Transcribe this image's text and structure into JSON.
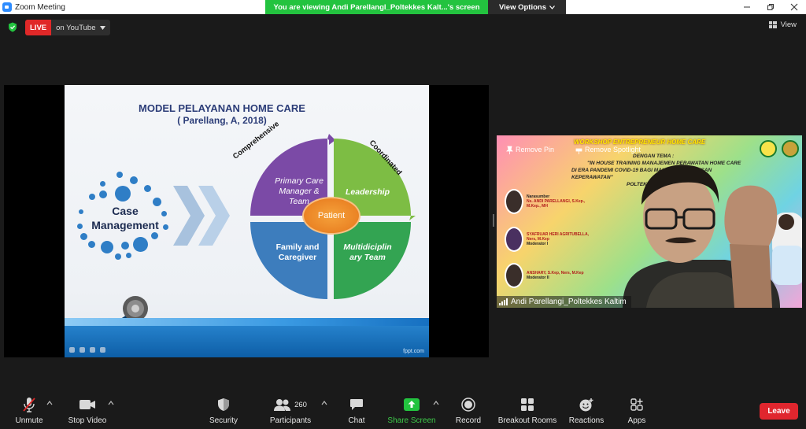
{
  "window": {
    "title": "Zoom Meeting",
    "share_message": "You are viewing Andi Parellangl_Poltekkes Kalt...'s screen",
    "view_options": "View Options"
  },
  "status": {
    "live": "LIVE",
    "platform": "on YouTube",
    "view": "View"
  },
  "slide": {
    "title": "MODEL PELAYANAN HOME CARE",
    "subtitle": "( Parellang, A, 2018)",
    "case_line1": "Case",
    "case_line2": "Management",
    "arc_left": "Comprehensive",
    "arc_right": "Coordinated",
    "quad_tl_1": "Primary Care",
    "quad_tl_2": "Manager &",
    "quad_tl_3": "Team",
    "quad_tr": "Leadership",
    "quad_bl_1": "Family and",
    "quad_bl_2": "Caregiver",
    "quad_br_1": "Multidiciplin",
    "quad_br_2": "ary Team",
    "center": "Patient",
    "footer": "fppt.com",
    "colors": {
      "quad_tl": "#7b4aa6",
      "quad_tr": "#7dbd44",
      "quad_bl": "#3d7dbd",
      "quad_br": "#33a452",
      "center": "#ea7e22"
    }
  },
  "video": {
    "banner_title": "WORKSHOP ENTREPRENEUR HOME CARE",
    "theme_label": "DENGAN TEMA :",
    "theme_line1": "\"IN HOUSE TRAINING MANAJEMEN PERAWATAN HOME CARE",
    "theme_line2": "DI ERA PANDEMI COVID-19 BAGI MAHASISWA JURUSAN KEPERAWATAN\"",
    "theme_line3": "POLTEKKES",
    "remove_pin": "Remove Pin",
    "remove_spotlight": "Remove Spotlight",
    "speaker1_role": "Narasumber",
    "speaker1_name": "Ns. ANDI PARELLANGI, S.Kep., M.Kep., MH",
    "speaker2_name": "SYAFRUAR HERI AGRITUBELLA, Ners, M.Kep",
    "speaker2_role": "Moderator I",
    "speaker3_name": "ANSHARY, S.Kep, Ners, M.Kep",
    "speaker3_role": "Moderator II",
    "participant_name": "Andi Parellangi_Poltekkes Kaltim"
  },
  "toolbar": {
    "unmute": "Unmute",
    "stop_video": "Stop Video",
    "security": "Security",
    "participants": "Participants",
    "participants_count": "260",
    "chat": "Chat",
    "share_screen": "Share Screen",
    "record": "Record",
    "breakout_rooms": "Breakout Rooms",
    "reactions": "Reactions",
    "apps": "Apps",
    "leave": "Leave",
    "colors": {
      "leave": "#e0262e",
      "share": "#23c33f",
      "live": "#e02828"
    }
  }
}
